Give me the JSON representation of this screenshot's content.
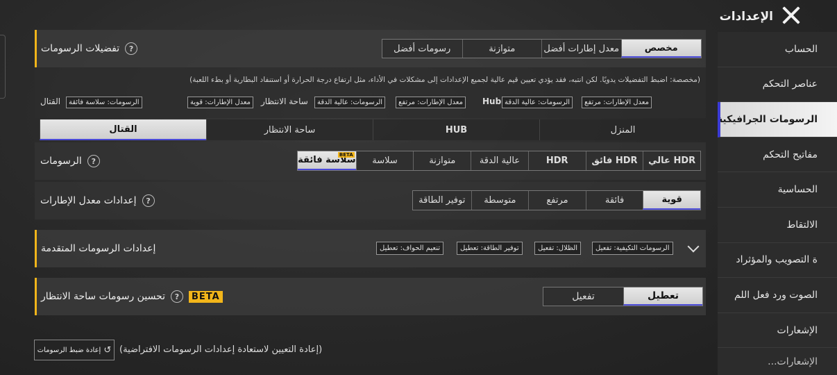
{
  "header": {
    "title": "الإعدادات",
    "close_icon": "close-icon"
  },
  "sidebar": {
    "items": [
      {
        "label": "الحساب"
      },
      {
        "label": "عناصر التحكم"
      },
      {
        "label": "الرسومات الجرافيكية",
        "active": true
      },
      {
        "label": "مفاتيح التحكم"
      },
      {
        "label": "الحساسية"
      },
      {
        "label": "الالتقاط"
      },
      {
        "label": "ة التصويب والمؤثراد"
      },
      {
        "label": "الصوت ورد فعل اللم"
      },
      {
        "label": "الإشعارات"
      },
      {
        "label": "...الإشعارات"
      }
    ]
  },
  "preferences": {
    "label": "تفضيلات الرسومات",
    "options": [
      "مخصص",
      "معدل إطارات أفضل",
      "متوازنة",
      "رسومات أفضل"
    ],
    "selected": 0
  },
  "info": {
    "text": "(مخصصة: اضبط التفضيلات يدويًا. لكن انتبه، فقد يؤدي تعيين قيم عالية لجميع الإعدادات إلى مشكلات في الأداء، مثل ارتفاع درجة الحرارة أو استنفاد البطارية أو بطء اللعبة)",
    "hub_label": "Hub",
    "lobby_label": "ساحة الانتظار",
    "battle_label": "القتال",
    "hub_fps": "معدل الإطارات: مرتفع",
    "hub_gfx": "الرسومات: عالية الدقة",
    "lobby_fps": "معدل الإطارات: مرتفع",
    "lobby_gfx": "الرسومات: عالية الدقة",
    "battle_fps": "معدل الإطارات: قوية",
    "battle_gfx": "الرسومات: سلاسة فائقة"
  },
  "scene_tabs": {
    "items": [
      "المنزل",
      "HUB",
      "ساحة الانتظار",
      "القتال"
    ],
    "selected": 3
  },
  "graphics": {
    "label": "الرسومات",
    "options": [
      "عالي HDR",
      "فائق HDR",
      "HDR",
      "عالية الدقة",
      "متوازنة",
      "سلاسة",
      "سلاسة فائقة"
    ],
    "selected": 6,
    "beta": "BETA"
  },
  "fps": {
    "label": "إعدادات معدل الإطارات",
    "options": [
      "قوية",
      "فائقة",
      "مرتفع",
      "متوسطة",
      "توفير الطاقة"
    ],
    "selected": 0
  },
  "advanced": {
    "label": "إعدادات الرسومات المتقدمة",
    "chips": [
      "الرسومات التكيفية: تفعيل",
      "الظلال: تفعيل",
      "توفير الطاقة: تعطيل",
      "تنعيم الحواف: تعطيل"
    ]
  },
  "lobby_opt": {
    "label": "تحسين رسومات ساحة الانتظار",
    "beta": "BETA",
    "options": [
      "تعطيل",
      "تفعيل"
    ],
    "selected": 0
  },
  "reset": {
    "button": "إعادة ضبط الرسومات",
    "note": "(إعادة التعيين لاستعادة إعدادات الرسومات الافتراضية)"
  }
}
